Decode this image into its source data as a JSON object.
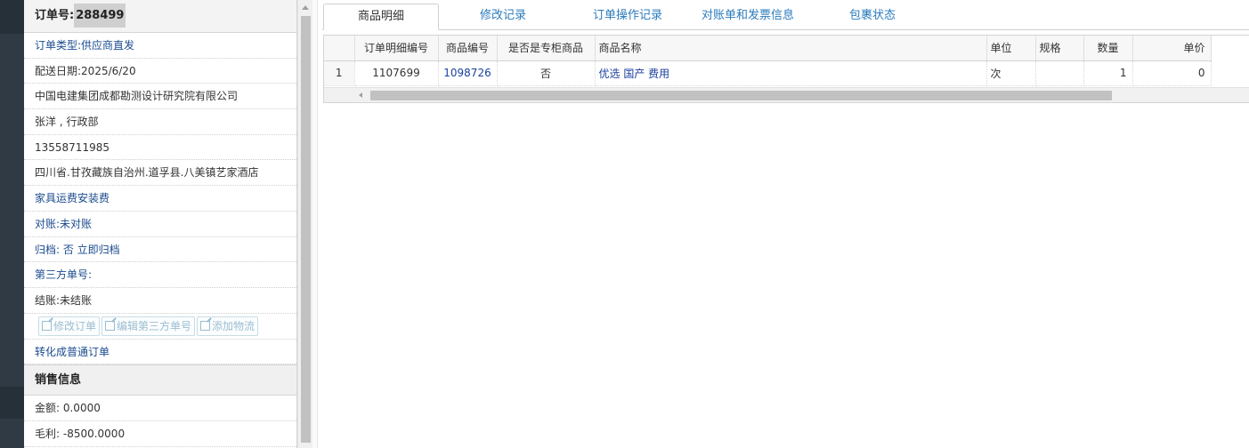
{
  "order": {
    "number_label": "订单号:",
    "number": "288499",
    "type": "订单类型:供应商直发",
    "delivery_date": "配送日期:2025/6/20",
    "company": "中国电建集团成都勘测设计研究院有限公司",
    "contact": "张洋 , 行政部",
    "phone": "13558711985",
    "address": "四川省.甘孜藏族自治州.道孚县.八美镇艺家酒店",
    "category": "家具运费安装费",
    "reconcile": "对账:未对账",
    "archive": "归档:  否 立即归档",
    "third_party": "第三方单号:",
    "settlement": "结账:未结账",
    "buttons": [
      "修改订单",
      "编辑第三方单号",
      "添加物流"
    ],
    "convert": "转化成普通订单"
  },
  "sales": {
    "title": "销售信息",
    "amount": "金额: 0.0000",
    "profit": "毛利: -8500.0000"
  },
  "tabs": [
    "商品明细",
    "修改记录",
    "订单操作记录",
    "对账单和发票信息",
    "包裹状态"
  ],
  "grid": {
    "columns": [
      "",
      "订单明细编号",
      "商品编号",
      "是否是专柜商品",
      "商品名称",
      "单位",
      "规格",
      "数量",
      "单价"
    ],
    "rows": [
      [
        "1",
        "1107699",
        "1098726",
        "否",
        "优选 国产 费用",
        "次",
        "",
        "1",
        "0"
      ]
    ]
  }
}
